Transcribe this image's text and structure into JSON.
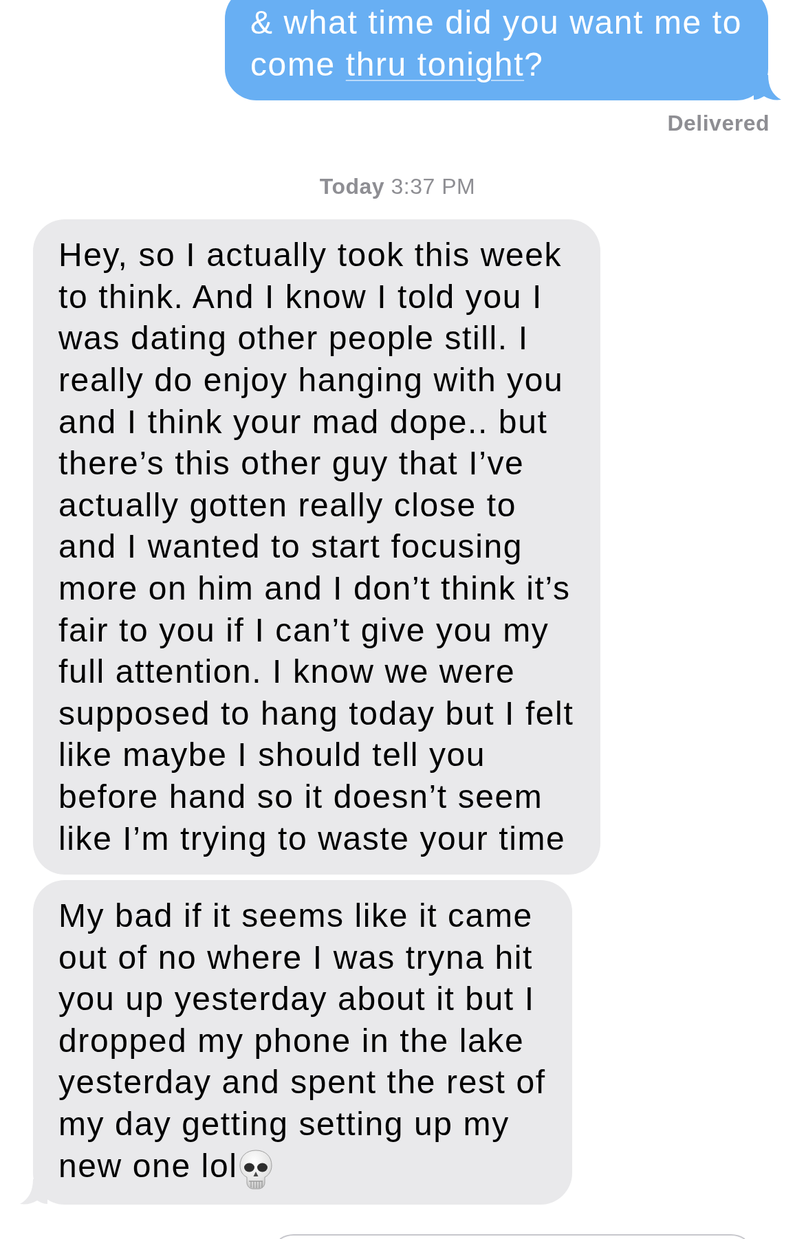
{
  "conversation": [
    {
      "kind": "sent",
      "parts": [
        {
          "kind": "plain",
          "text": "& what time did you want me to come "
        },
        {
          "kind": "link",
          "text": "thru tonight"
        },
        {
          "kind": "plain",
          "text": "?"
        }
      ],
      "tail": true
    },
    {
      "kind": "status",
      "text": "Delivered"
    },
    {
      "kind": "timestamp",
      "text": "**Today** 3:37 PM"
    },
    {
      "kind": "received",
      "parts": [
        {
          "kind": "plain",
          "text": "Hey, so I actually took this week to think. And I know I told you I was dating other people still. I really do enjoy hanging with you and I think your mad dope.. but there’s this other guy that I’ve actually gotten really close to and I wanted to start focusing more on him and I don’t think it’s fair to you if I can’t give you my full attention. I know we were supposed to hang today but I felt like maybe I should tell you before hand so it doesn’t seem like I’m trying to waste your time"
        }
      ],
      "tail": false
    },
    {
      "kind": "received",
      "parts": [
        {
          "kind": "plain",
          "text": "My bad if it seems like it came out of no where I was tryna hit you up yesterday about it but I dropped my phone in the lake yesterday and spent the rest of my day getting setting up my new one lol"
        },
        {
          "kind": "skull"
        }
      ],
      "tail": true
    }
  ],
  "composer": {
    "kind": "text-field"
  }
}
